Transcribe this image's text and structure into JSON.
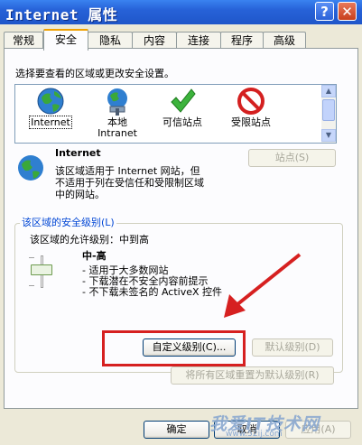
{
  "window": {
    "title": "Internet 属性",
    "help": "?",
    "close": "✕"
  },
  "tabs": [
    "常规",
    "安全",
    "隐私",
    "内容",
    "连接",
    "程序",
    "高级"
  ],
  "active_tab": "安全",
  "zones_prompt": "选择要查看的区域或更改安全设置。",
  "zones": [
    {
      "name": "Internet",
      "name2": "",
      "icon": "globe-icon"
    },
    {
      "name": "本地",
      "name2": "Intranet",
      "icon": "network-globe-icon"
    },
    {
      "name": "可信站点",
      "name2": "",
      "icon": "checkmark-icon"
    },
    {
      "name": "受限站点",
      "name2": "",
      "icon": "no-entry-icon"
    }
  ],
  "zone_detail": {
    "title": "Internet",
    "desc1": "该区域适用于 Internet 网站，但",
    "desc2": "不适用于列在受信任和受限制区域",
    "desc3": "中的网站。",
    "sites_button": "站点(S)"
  },
  "security": {
    "group_label": "该区域的安全级别(L)",
    "allowed_level": "该区域的允许级别：中到高",
    "level_name": "中-高",
    "bullets": [
      "- 适用于大多数网站",
      "- 下载潜在不安全内容前提示",
      "- 不下载未签名的 ActiveX 控件"
    ],
    "slider_level": "中-高",
    "custom_button": "自定义级别(C)...",
    "default_button": "默认级别(D)",
    "reset_all_button": "将所有区域重置为默认级别(R)"
  },
  "footer": {
    "ok": "确定",
    "cancel": "取消",
    "apply": "应用(A)"
  },
  "watermark": {
    "text": "我爱IT技术网",
    "url": "www.52ij.com"
  },
  "colors": {
    "titlebar": "#2762d8",
    "accent": "#f0a000",
    "annotation_red": "#d62020"
  }
}
